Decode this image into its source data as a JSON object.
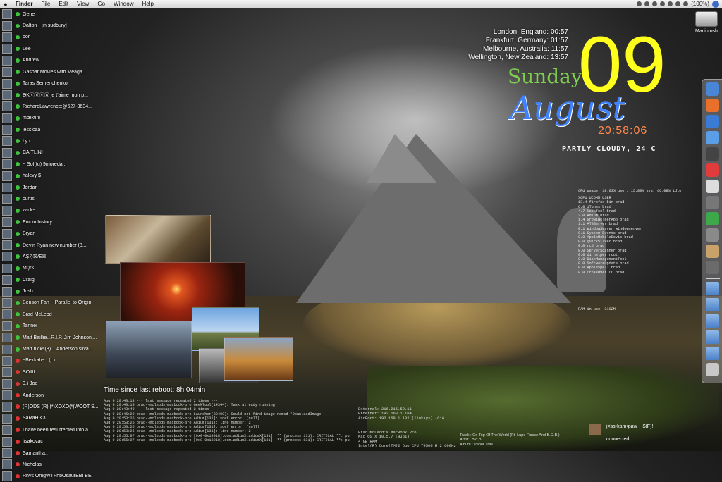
{
  "menubar": {
    "apple_icon": "apple-icon",
    "menus": [
      "Finder",
      "File",
      "Edit",
      "View",
      "Go",
      "Window",
      "Help"
    ],
    "battery": "(100%)"
  },
  "contacts": [
    {
      "name": "Gene",
      "status": "available"
    },
    {
      "name": "Dalton - [in sudbury]",
      "status": "available"
    },
    {
      "name": "bor",
      "status": "available"
    },
    {
      "name": "Lee",
      "status": "available"
    },
    {
      "name": "Andrew",
      "status": "available"
    },
    {
      "name": "Gaspar    Movies with Meaga...",
      "status": "available"
    },
    {
      "name": "Taras Semenchenko",
      "status": "available"
    },
    {
      "name": "ƏKⓒⓓⓔⒶ je t'aime mon p...",
      "status": "available"
    },
    {
      "name": "RichardLawrence:@627-3634...",
      "status": "available"
    },
    {
      "name": "mœxtini",
      "status": "available"
    },
    {
      "name": "jessicaa",
      "status": "available"
    },
    {
      "name": "Ly:(",
      "status": "available"
    },
    {
      "name": "CAITLIN!",
      "status": "available"
    },
    {
      "name": "~             Sof(tu)      9moreda...",
      "status": "available"
    },
    {
      "name": "halevy $",
      "status": "available"
    },
    {
      "name": "Jordan",
      "status": "available"
    },
    {
      "name": "curtis",
      "status": "available"
    },
    {
      "name": "zack~",
      "status": "available"
    },
    {
      "name": "Eric in history",
      "status": "available"
    },
    {
      "name": "Bryan",
      "status": "available"
    },
    {
      "name": "Devin Ryan      new number (8...",
      "status": "available"
    },
    {
      "name": "ÅŞℌℜÆℍ",
      "status": "available"
    },
    {
      "name": "M:)rk",
      "status": "available"
    },
    {
      "name": "Craig",
      "status": "available"
    },
    {
      "name": "Josh",
      "status": "available"
    },
    {
      "name": "Benson Fan ~ Parallel to Origin",
      "status": "available"
    },
    {
      "name": "Brad McLeod",
      "status": "available"
    },
    {
      "name": "Tanner",
      "status": "available"
    },
    {
      "name": "Matt Baillie...R.I.P. Jim Johnson,...",
      "status": "available"
    },
    {
      "name": "Matt hicks(8)....Anderson silva...",
      "status": "available"
    },
    {
      "name": "~Bekkah~...(L)",
      "status": "away"
    },
    {
      "name": "SOffff",
      "status": "away"
    },
    {
      "name": "0.) Joo",
      "status": "away"
    },
    {
      "name": "Anderson",
      "status": "away"
    },
    {
      "name": "(R)ODS (R) (*)XOXO(*)WOOT S...",
      "status": "away"
    },
    {
      "name": "SaRaH <3",
      "status": "away"
    },
    {
      "name": "I have been resurrected into a...",
      "status": "away"
    },
    {
      "name": "lisakovac",
      "status": "away"
    },
    {
      "name": "Samantha;;",
      "status": "away"
    },
    {
      "name": "Nicholas",
      "status": "away"
    },
    {
      "name": "Rhys  OmgWTFhbOsaurEBI BE",
      "status": "away"
    }
  ],
  "world_clocks": [
    "London, England: 00:57",
    "Frankfurt, Germany: 01:57",
    "Melbourne, Australia: 11:57",
    "Wellington, New Zealand: 13:57"
  ],
  "date": {
    "day_number": "09",
    "weekday": "Sunday",
    "month": "August",
    "time": "20:58:06"
  },
  "weather": "PARTLY CLOUDY, 24 C",
  "system": {
    "cpu_usage": "CPU usage: 18.03% user, 15.88% sys, 66.09% idle",
    "process_header": "%CPU UCOMM         USER",
    "processes": [
      "13.4 firefox-bin    brad",
      " 6.0 iTunes         brad",
      " 4.7 GeekTool       brad",
      " 3.0 Adium          brad",
      " 1.4 GrowlHelperApp brad",
      " 1.1 ATSServer      brad",
      " 0.1 WindowServer   windowserver",
      " 0.1 System Events  brad",
      " 0.0 AppleMobileDevic brad",
      " 0.0 QuickSilver    brad",
      " 0.0 rcd            brad",
      " 0.0 ServerScanner  brad",
      " 0.0 dirhelper      root",
      " 0.0 DiskManagementTool",
      " 0.0 SoftwareUpdate brad",
      " 0.0 AppleSpell     brad",
      " 0.0 CrossOver CD   brad"
    ],
    "ram_in_use": "RAM in use: 3102M"
  },
  "reboot": "Time since last reboot: 8h 04min",
  "log_lines": [
    "Aug  9 20:43:18 --- last message repeated 2 times ---",
    "Aug  9 20:43:19 brad--mcleods-macbook-pro GeekTool[14344]: Task already running",
    "Aug  9 20:43:49 --- last message repeated 2 times ---",
    "Aug  9 20:45:20 brad--mcleods-macbook-pro Launcher[80490]: Could not find image named 'DownloadImage'.",
    "Aug  9 20:53:26 brad--mcleods-macbook-pro Adium[131]: sdef error: (null)",
    "Aug  9 20:53:26 brad--mcleods-macbook-pro Adium[131]: line number: 2",
    "Aug  9 20:53:26 brad--mcleods-macbook-pro Adium[131]: sdef error: (null)",
    "Aug  9 20:53:26 brad--mcleods-macbook-pro Adium[131]: line number: 2",
    "Aug  9 20:55:07 brad--mcleods-macbook-pro [0x0-0x18018].com.adiumX.adiumX[131]: ** (process:131): CRITICAL **: purple_notify_",
    "Aug  9 20:55:07 brad--mcleods-macbook-pro [0x0-0x18018].com.adiumX.adiumX[131]: ** (process:131): CRITICAL **: purple_request"
  ],
  "network": [
    "External: 216.215.59.11",
    "Ethernet: 192.168.1.104",
    "AirPort: 192.168.1.102 (linksys) -C16"
  ],
  "sysinfo": [
    "Brad McLeod's MacBook Pro",
    "Mac OS X 10.5.7 (9J61)",
    "4 GB RAM",
    "Intel(R) Core(TM)2 Duo CPU     T9500  @ 2.60GHz"
  ],
  "track": [
    "Track : On Top Of The World (Ft. Lupe Fiasco And B.O.B.)",
    "Artist : B.o.B",
    "Album : Paper Trail"
  ],
  "chat_status": {
    "name": "j<ss•kam•paw~ :$(F)!",
    "status": "connected"
  },
  "desktop_icon": {
    "label": "Macintosh"
  },
  "dock_items": [
    "finder-icon",
    "firefox-icon",
    "itunes-icon",
    "safari-icon",
    "clock-icon",
    "calendar-icon",
    "alarm-icon",
    "ipod-icon",
    "adium-icon",
    "preferences-icon",
    "photos-icon",
    "tools-icon",
    "folder-icon",
    "folder-icon",
    "folder-icon",
    "folder-icon",
    "folder-icon",
    "trash-icon"
  ]
}
